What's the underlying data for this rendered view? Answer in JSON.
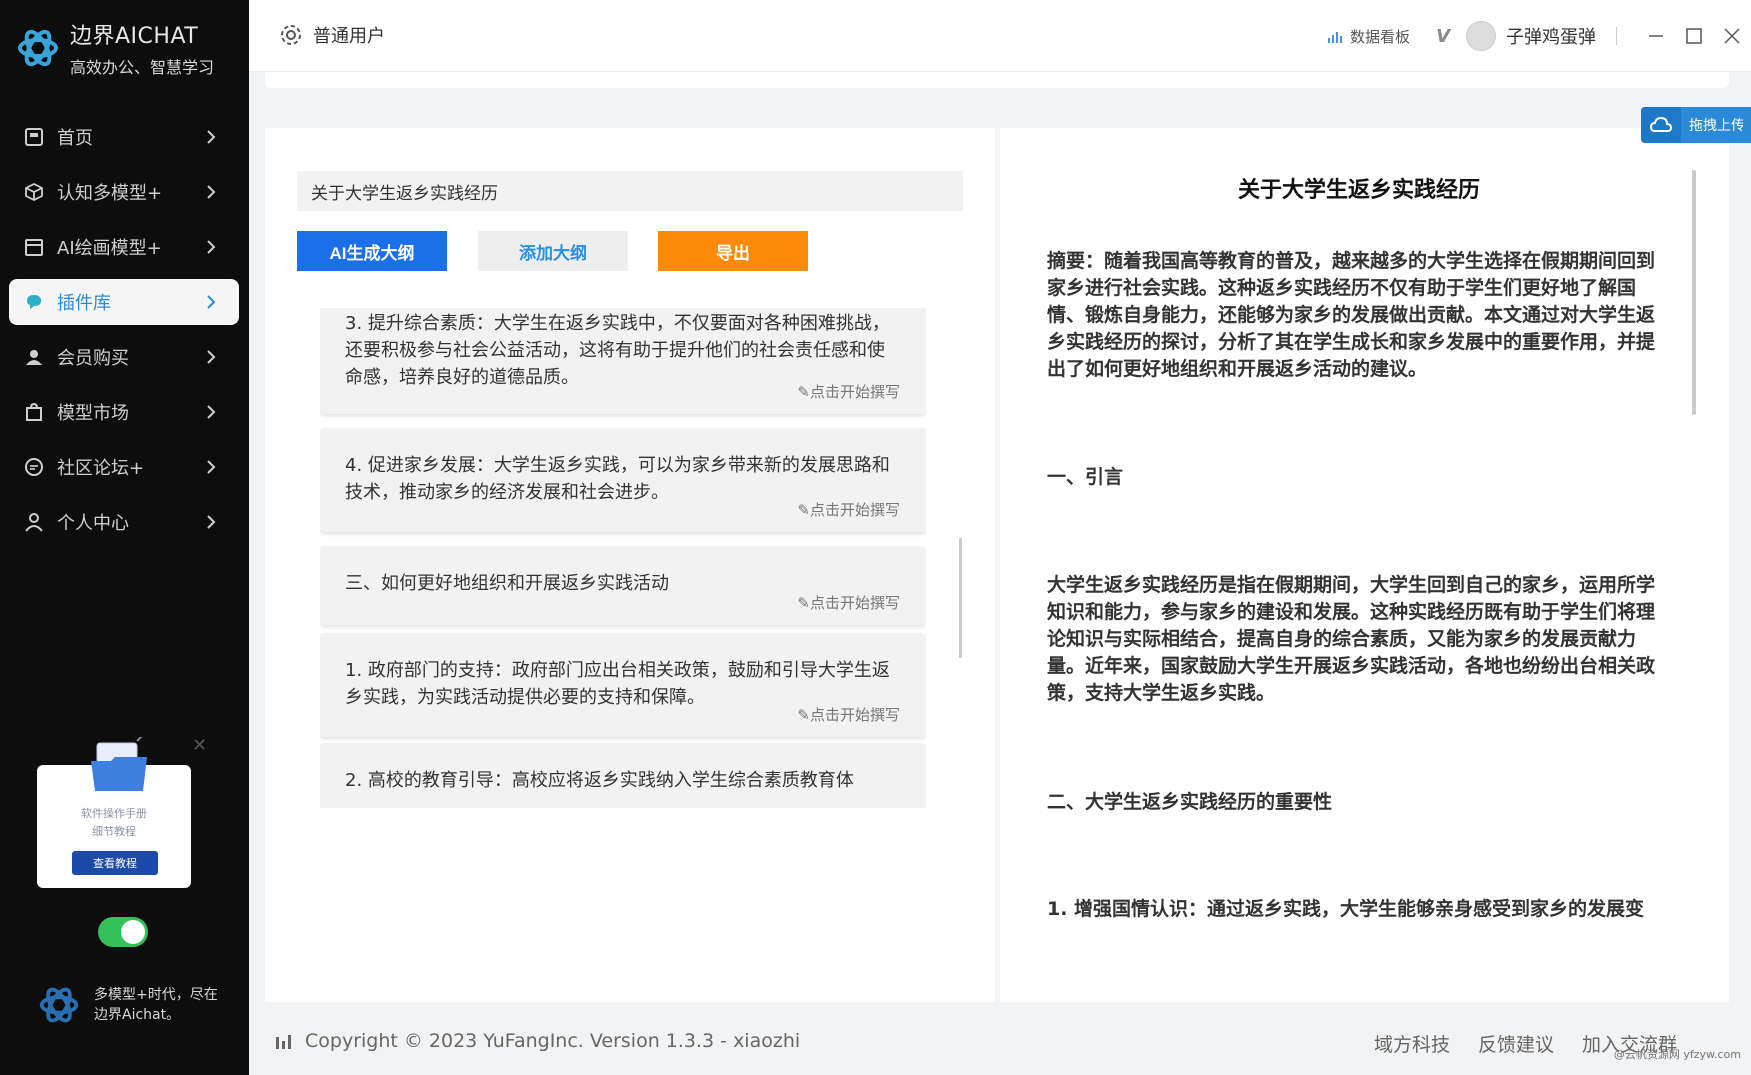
{
  "brand": {
    "name": "边界AICHAT",
    "slogan": "高效办公、智慧学习"
  },
  "sidebar": {
    "items": [
      {
        "label": "首页",
        "icon": "home-icon"
      },
      {
        "label": "认知多模型+",
        "icon": "cube-icon"
      },
      {
        "label": "AI绘画模型+",
        "icon": "calendar-icon"
      },
      {
        "label": "插件库",
        "icon": "plugin-icon",
        "active": true
      },
      {
        "label": "会员购买",
        "icon": "member-icon"
      },
      {
        "label": "模型市场",
        "icon": "bag-icon"
      },
      {
        "label": "社区论坛+",
        "icon": "chat-icon"
      },
      {
        "label": "个人中心",
        "icon": "user-icon"
      }
    ],
    "tutorial": {
      "title": "软件操作手册",
      "subtitle": "细节教程",
      "button": "查看教程"
    },
    "footer_slogan": "多模型+时代，尽在边界Aichat。"
  },
  "header": {
    "user_type": "普通用户",
    "dashboard": "数据看板",
    "vip": "V",
    "username": "子弹鸡蛋弹"
  },
  "editor": {
    "title_value": "关于大学生返乡实践经历",
    "buttons": {
      "ai": "AI生成大纲",
      "add": "添加大纲",
      "export": "导出"
    },
    "edit_label": "点击开始撰写",
    "cards": [
      {
        "text": "3. 提升综合素质：大学生在返乡实践中，不仅要面对各种困难挑战，还要积极参与社会公益活动，这将有助于提升他们的社会责任感和使命感，培养良好的道德品质。"
      },
      {
        "text": "4. 促进家乡发展：大学生返乡实践，可以为家乡带来新的发展思路和技术，推动家乡的经济发展和社会进步。"
      },
      {
        "text": "三、如何更好地组织和开展返乡实践活动"
      },
      {
        "text": "1. 政府部门的支持：政府部门应出台相关政策，鼓励和引导大学生返乡实践，为实践活动提供必要的支持和保障。"
      },
      {
        "text": "2. 高校的教育引导：高校应将返乡实践纳入学生综合素质教育体"
      }
    ]
  },
  "document": {
    "title": "关于大学生返乡实践经历",
    "abstract": "摘要：随着我国高等教育的普及，越来越多的大学生选择在假期期间回到家乡进行社会实践。这种返乡实践经历不仅有助于学生们更好地了解国情、锻炼自身能力，还能够为家乡的发展做出贡献。本文通过对大学生返乡实践经历的探讨，分析了其在学生成长和家乡发展中的重要作用，并提出了如何更好地组织和开展返乡活动的建议。",
    "section1": "一、引言",
    "para1": "大学生返乡实践经历是指在假期期间，大学生回到自己的家乡，运用所学知识和能力，参与家乡的建设和发展。这种实践经历既有助于学生们将理论知识与实际相结合，提高自身的综合素质，又能为家乡的发展贡献力量。近年来，国家鼓励大学生开展返乡实践活动，各地也纷纷出台相关政策，支持大学生返乡实践。",
    "section2": "二、大学生返乡实践经历的重要性",
    "point1": "1. 增强国情认识：通过返乡实践，大学生能够亲身感受到家乡的发展变"
  },
  "upload_tag": "拖拽上传",
  "footer": {
    "copyright": "Copyright © 2023 YuFangInc. Version 1.3.3 - xiaozhi",
    "links": [
      "域方科技",
      "反馈建议",
      "加入交流群"
    ],
    "watermark": "@云帆资源网 yfzyw.com"
  },
  "colors": {
    "accent": "#2b8ad8",
    "primary_btn": "#1b6fe8",
    "export_btn": "#ff8a0a",
    "toggle": "#35c15a"
  }
}
